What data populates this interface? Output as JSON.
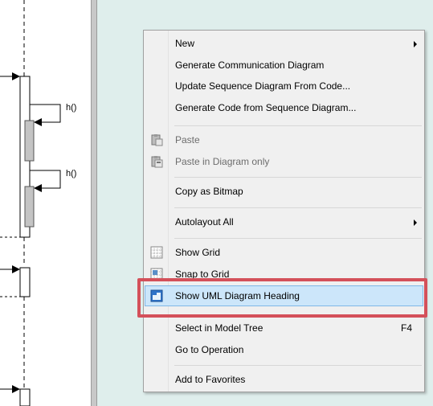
{
  "diagram": {
    "message_labels": [
      "h()",
      "h()"
    ]
  },
  "menu": {
    "items": [
      {
        "label": "New",
        "submenu": true,
        "disabled": false,
        "icon": null
      },
      {
        "label": "Generate Communication Diagram",
        "disabled": false,
        "icon": null
      },
      {
        "label": "Update Sequence Diagram From Code...",
        "disabled": false,
        "icon": null
      },
      {
        "label": "Generate Code from Sequence Diagram...",
        "disabled": false,
        "icon": null
      },
      {
        "label": "Paste",
        "disabled": true,
        "icon": "clipboard-icon"
      },
      {
        "label": "Paste in Diagram only",
        "disabled": true,
        "icon": "clipboard-diagram-icon"
      },
      {
        "label": "Copy as Bitmap",
        "disabled": false,
        "icon": null
      },
      {
        "label": "Autolayout All",
        "submenu": true,
        "disabled": false,
        "icon": null
      },
      {
        "label": "Show Grid",
        "disabled": false,
        "icon": "grid-icon"
      },
      {
        "label": "Snap to Grid",
        "disabled": false,
        "icon": "snap-grid-icon"
      },
      {
        "label": "Show UML Diagram Heading",
        "disabled": false,
        "icon": "diagram-heading-icon",
        "highlighted": true
      },
      {
        "label": "Select in Model Tree",
        "shortcut": "F4",
        "disabled": false,
        "icon": null
      },
      {
        "label": "Go to Operation",
        "disabled": false,
        "icon": null
      },
      {
        "label": "Add to Favorites",
        "disabled": false,
        "icon": null
      }
    ]
  },
  "colors": {
    "background": "#dfeeec",
    "highlight_fill": "#cce6fa",
    "highlight_border": "#7fb8e6",
    "callout_outline": "#d4505a"
  }
}
